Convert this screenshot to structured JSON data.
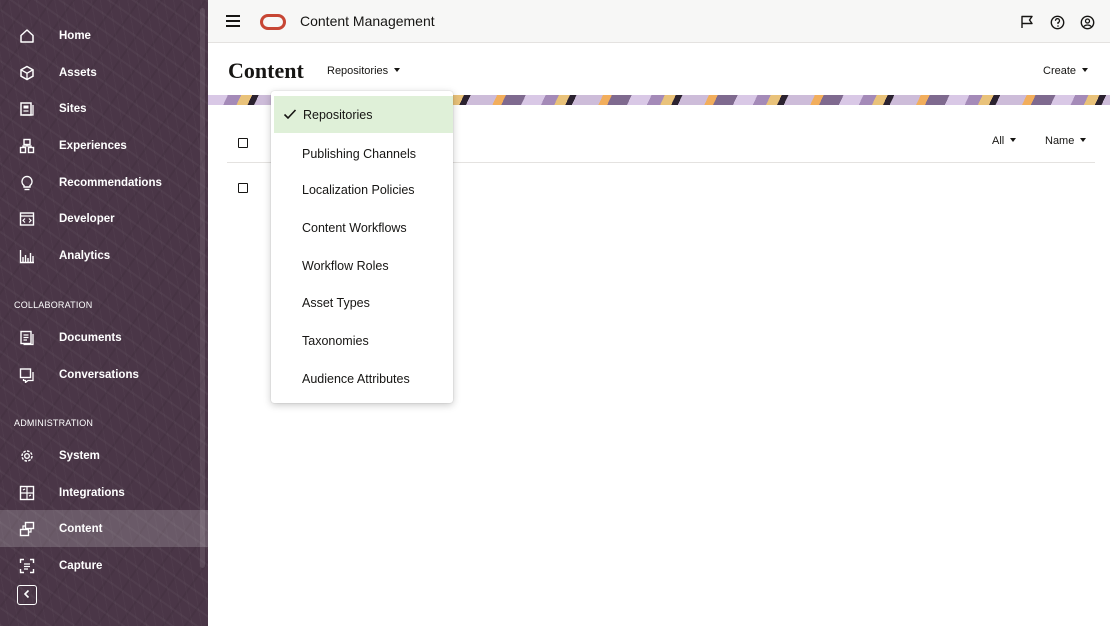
{
  "topbar": {
    "app_title": "Content Management",
    "icons": [
      "hamburger-menu-icon",
      "oracle-logo",
      "flag-icon",
      "help-icon",
      "user-profile-icon"
    ]
  },
  "sidebar": {
    "items": [
      {
        "label": "Home",
        "icon": "home-icon"
      },
      {
        "label": "Assets",
        "icon": "assets-icon"
      },
      {
        "label": "Sites",
        "icon": "sites-icon"
      },
      {
        "label": "Experiences",
        "icon": "experiences-icon"
      },
      {
        "label": "Recommendations",
        "icon": "recommendations-icon"
      },
      {
        "label": "Developer",
        "icon": "developer-icon"
      },
      {
        "label": "Analytics",
        "icon": "analytics-icon"
      }
    ],
    "collaboration_heading": "COLLABORATION",
    "collaboration_items": [
      {
        "label": "Documents",
        "icon": "documents-icon"
      },
      {
        "label": "Conversations",
        "icon": "conversations-icon"
      }
    ],
    "administration_heading": "ADMINISTRATION",
    "administration_items": [
      {
        "label": "System",
        "icon": "system-gear-icon"
      },
      {
        "label": "Integrations",
        "icon": "integrations-icon"
      },
      {
        "label": "Content",
        "icon": "content-icon",
        "active": true
      },
      {
        "label": "Capture",
        "icon": "capture-icon"
      }
    ],
    "collapse_icon": "chevron-left-icon"
  },
  "page": {
    "title": "Content",
    "repo_switch_label": "Repositories",
    "create_label": "Create",
    "filter_label": "All",
    "sort_label": "Name"
  },
  "dropdown": {
    "items": [
      {
        "label": "Repositories",
        "selected": true
      },
      {
        "label": "Publishing Channels"
      },
      {
        "label": "Localization Policies"
      },
      {
        "label": "Content Workflows"
      },
      {
        "label": "Workflow Roles"
      },
      {
        "label": "Asset Types"
      },
      {
        "label": "Taxonomies"
      },
      {
        "label": "Audience Attributes"
      }
    ]
  },
  "colors": {
    "sidebar_bg": "#4a3647",
    "oracle_red": "#c74634",
    "selected_item_bg": "#dff0d8"
  }
}
